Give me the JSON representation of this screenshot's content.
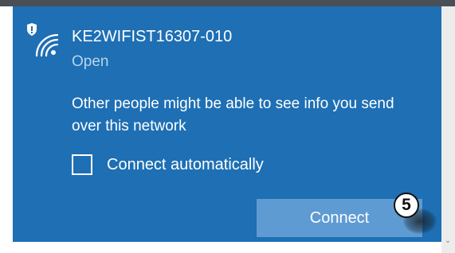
{
  "network": {
    "ssid": "KE2WIFIST16307-010",
    "status": "Open",
    "warning": "Other people might be able to see info you send over this network"
  },
  "options": {
    "connect_automatically_label": "Connect automatically",
    "connect_automatically_checked": false
  },
  "actions": {
    "connect_label": "Connect"
  },
  "callout": {
    "step_number": "5"
  },
  "icons": {
    "network": "wifi-open-shield-icon",
    "expand": "chevron-down-icon"
  },
  "colors": {
    "panel_background": "#1e6fb4",
    "secondary_text": "#b8d4ee",
    "button_background": "#5e9bd3"
  }
}
